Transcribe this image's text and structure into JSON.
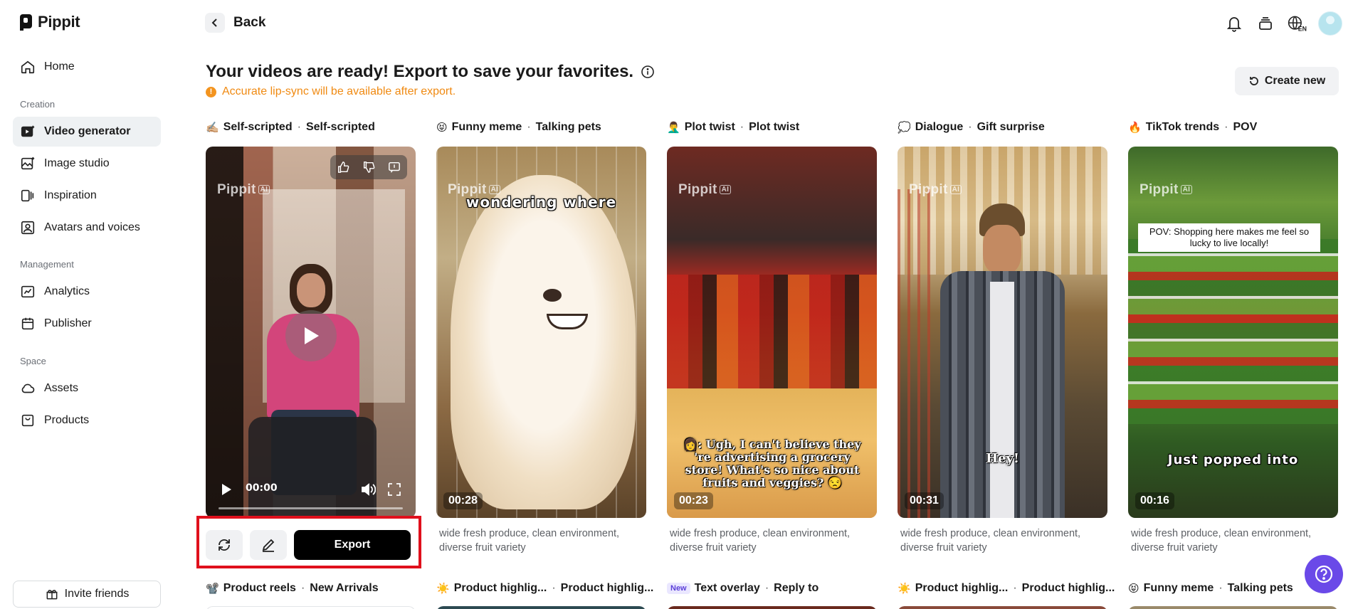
{
  "app": {
    "name": "Pippit"
  },
  "sidebar": {
    "home": "Home",
    "sections": {
      "creation": "Creation",
      "management": "Management",
      "space": "Space"
    },
    "creation_items": [
      "Video generator",
      "Image studio",
      "Inspiration",
      "Avatars and voices"
    ],
    "management_items": [
      "Analytics",
      "Publisher"
    ],
    "space_items": [
      "Assets",
      "Products"
    ],
    "invite": "Invite friends"
  },
  "topbar": {
    "back": "Back",
    "language_badge": "EN"
  },
  "heading": {
    "title": "Your videos are ready! Export to save your favorites.",
    "notice": "Accurate lip-sync will be available after export.",
    "create_new": "Create new"
  },
  "cards": [
    {
      "emoji": "✍🏼",
      "category": "Self-scripted",
      "subcategory": "Self-scripted",
      "time": "00:00",
      "description": ""
    },
    {
      "emoji": "😝",
      "category": "Funny meme",
      "subcategory": "Talking pets",
      "duration": "00:28",
      "overlay": "wondering where",
      "description": "wide fresh produce, clean environment, diverse fruit variety"
    },
    {
      "emoji": "🤦‍♂️",
      "category": "Plot twist",
      "subcategory": "Plot twist",
      "duration": "00:23",
      "overlay": "👩: Ugh, I can't believe they 're advertising a grocery store! What's so nice about fruits and veggies? 😒",
      "description": "wide fresh produce, clean environment, diverse fruit variety"
    },
    {
      "emoji": "💭",
      "category": "Dialogue",
      "subcategory": "Gift surprise",
      "duration": "00:31",
      "overlay": "Hey!",
      "description": "wide fresh produce, clean environment, diverse fruit variety"
    },
    {
      "emoji": "🔥",
      "category": "TikTok trends",
      "subcategory": "POV",
      "duration": "00:16",
      "overlay": "POV: Shopping here makes me feel so lucky to live locally!",
      "overlay2": "Just popped into",
      "description": "wide fresh produce, clean environment, diverse fruit variety"
    }
  ],
  "watermark": {
    "text": "Pippit",
    "badge": "AI"
  },
  "actions": {
    "export": "Export"
  },
  "row2": [
    {
      "emoji": "📽️",
      "category": "Product reels",
      "subcategory": "New Arrivals"
    },
    {
      "emoji": "☀️",
      "category": "Product highlig...",
      "subcategory": "Product highlig..."
    },
    {
      "badge": "New",
      "category": "Text overlay",
      "subcategory": "Reply to"
    },
    {
      "emoji": "☀️",
      "category": "Product highlig...",
      "subcategory": "Product highlig..."
    },
    {
      "emoji": "😝",
      "category": "Funny meme",
      "subcategory": "Talking pets"
    }
  ],
  "colors": {
    "accent": "#6a49e8",
    "warning": "#f08a12",
    "highlight_frame": "#e0101c"
  }
}
